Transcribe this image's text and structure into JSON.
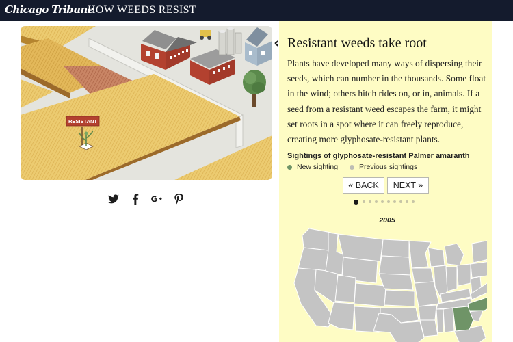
{
  "header": {
    "brand": "Chicago Tribune",
    "title": "HOW WEEDS RESIST"
  },
  "illustration": {
    "sign_label": "RESISTANT"
  },
  "share": {
    "items": [
      {
        "name": "twitter",
        "icon": "twitter-icon"
      },
      {
        "name": "facebook",
        "icon": "facebook-icon"
      },
      {
        "name": "google-plus",
        "icon": "google-plus-icon"
      },
      {
        "name": "pinterest",
        "icon": "pinterest-icon"
      }
    ]
  },
  "panel": {
    "title": "Resistant weeds take root",
    "body": "Plants have developed many ways of dispersing their seeds, which can number in the thousands. Some float in the wind; others hitch rides on, or in, animals. If a seed from a resistant weed escapes the farm, it might set roots in a spot where it can freely reproduce, creating more glyphosate-resistant plants.",
    "legend_title": "Sightings of glyphosate-resistant Palmer amaranth",
    "legend": [
      {
        "label": "New sighting",
        "color": "#6f9467"
      },
      {
        "label": "Previous sightings",
        "color": "#bdbdb4"
      }
    ],
    "back_label": "« BACK",
    "next_label": "NEXT »",
    "pager": {
      "total": 10,
      "current": 1
    }
  },
  "map": {
    "year": "2005",
    "new_sighting_states": [
      "Georgia",
      "North Carolina"
    ],
    "colors": {
      "base": "#c4c4c4",
      "border": "#ffffff",
      "new": "#6f9467"
    }
  },
  "colors": {
    "header_bg": "#141b2d",
    "panel_bg": "#fefcc4",
    "field_yellow": "#ecc96b",
    "field_brown": "#c47a58",
    "barn_red": "#b3412f"
  }
}
